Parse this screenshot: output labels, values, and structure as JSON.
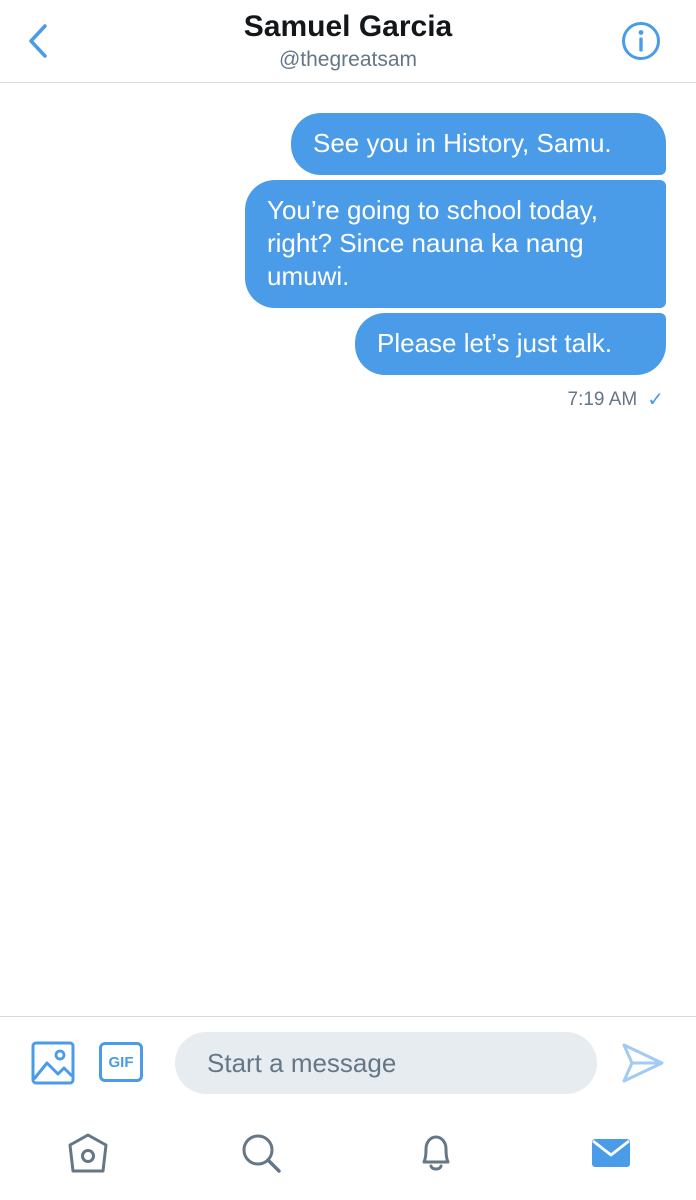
{
  "header": {
    "title": "Samuel Garcia",
    "handle": "@thegreatsam",
    "back_icon": "chevron-left-icon",
    "info_icon": "info-icon"
  },
  "messages": [
    {
      "text": "See you in History, Samu.",
      "sender": "me"
    },
    {
      "text": "You’re going to school today, right? Since nauna ka nang umuwi.",
      "sender": "me"
    },
    {
      "text": "Please let’s just talk.",
      "sender": "me"
    }
  ],
  "meta": {
    "time": "7:19 AM",
    "status_glyph": "✓"
  },
  "composer": {
    "placeholder": "Start a message",
    "value": "",
    "gif_label": "GIF",
    "photo_icon": "image-icon",
    "send_icon": "send-icon"
  },
  "tabbar": {
    "items": [
      {
        "icon": "home-icon",
        "active": false
      },
      {
        "icon": "search-icon",
        "active": false
      },
      {
        "icon": "bell-icon",
        "active": false
      },
      {
        "icon": "mail-icon",
        "active": true
      }
    ]
  },
  "colors": {
    "accent": "#4a9be8",
    "secondary_text": "#657786",
    "input_bg": "#e6ecf0",
    "divider": "#d7dbde",
    "inactive_icon": "#657786"
  }
}
